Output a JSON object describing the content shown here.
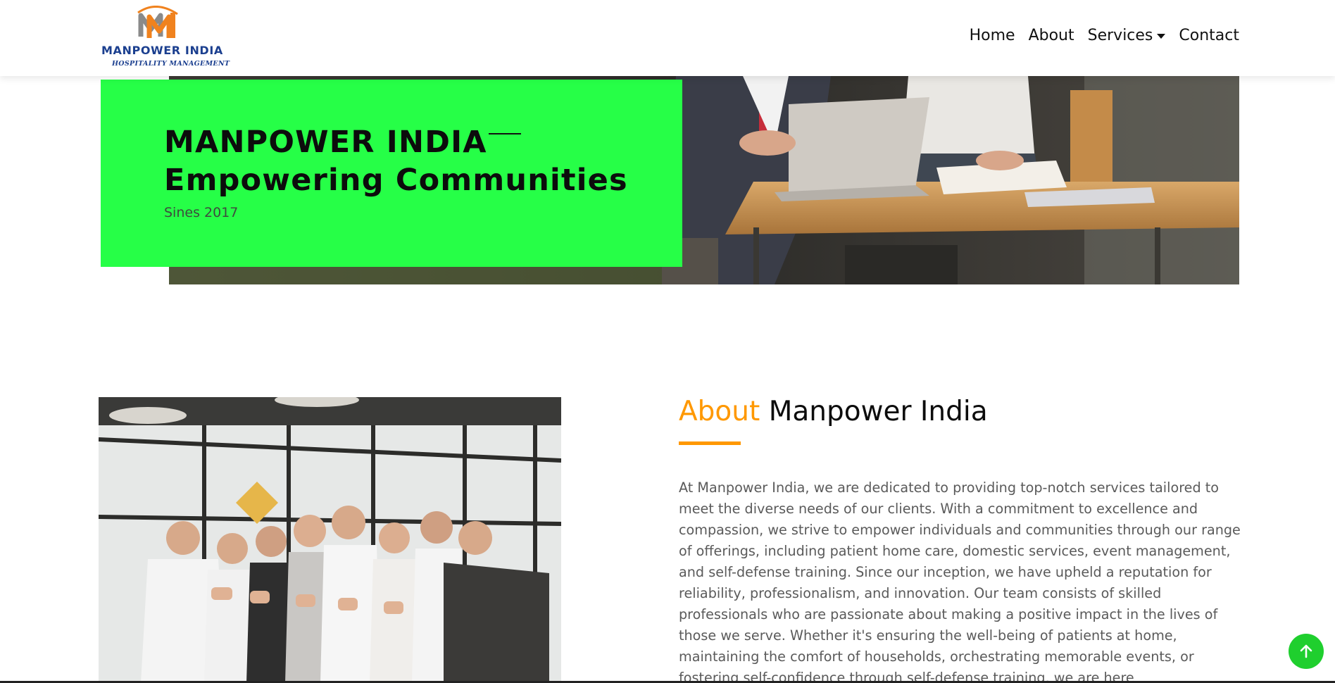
{
  "brand": {
    "name": "MANPOWER INDIA",
    "tagline": "HOSPITALITY MANAGEMENT",
    "colors": {
      "blue": "#1b3f8f",
      "orange": "#f0821e",
      "grey": "#8a8a8a"
    }
  },
  "nav": {
    "items": [
      {
        "label": "Home"
      },
      {
        "label": "About"
      },
      {
        "label": "Services"
      },
      {
        "label": "Contact"
      }
    ]
  },
  "hero": {
    "title_line1": "MANPOWER INDIA",
    "title_line2": "Empowering Communities",
    "subtitle": "Sines 2017",
    "card_color": "#26ff47"
  },
  "about": {
    "heading_accent": "About",
    "heading_rest": "Manpower India",
    "accent_color": "#ff9800",
    "paragraph": "At Manpower India, we are dedicated to providing top-notch services tailored to meet the diverse needs of our clients. With a commitment to excellence and compassion, we strive to empower individuals and communities through our range of offerings, including patient home care, domestic services, event management, and self-defense training. Since our inception, we have upheld a reputation for reliability, professionalism, and innovation. Our team consists of skilled professionals who are passionate about making a positive impact in the lives of those we serve. Whether it's ensuring the well-being of patients at home, maintaining the comfort of households, orchestrating memorable events, or fostering self-confidence through self-defense training, we are here"
  },
  "icons": {
    "scroll_top": "arrow-up-icon",
    "services_caret": "caret-down-icon"
  }
}
